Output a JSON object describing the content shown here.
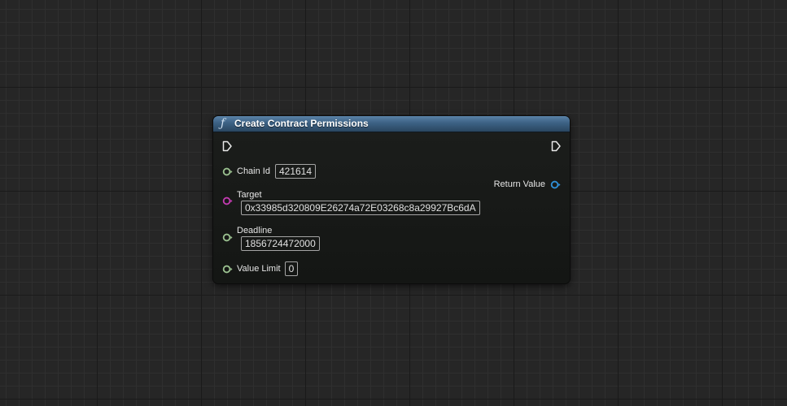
{
  "node": {
    "title": "Create Contract Permissions",
    "icon": "function-icon",
    "header_color": "#3c6184"
  },
  "inputs": {
    "chain_id": {
      "label": "Chain Id",
      "value": "421614",
      "pin_color": "#9ac08f"
    },
    "target": {
      "label": "Target",
      "value": "0x33985d320809E26274a72E03268c8a29927Bc6dA",
      "pin_color": "#c23bb0"
    },
    "deadline": {
      "label": "Deadline",
      "value": "1856724472000",
      "pin_color": "#9ac08f"
    },
    "value_limit": {
      "label": "Value Limit",
      "value": "0",
      "pin_color": "#9ac08f"
    }
  },
  "outputs": {
    "return_value": {
      "label": "Return Value",
      "pin_color": "#2f8fd6"
    }
  }
}
